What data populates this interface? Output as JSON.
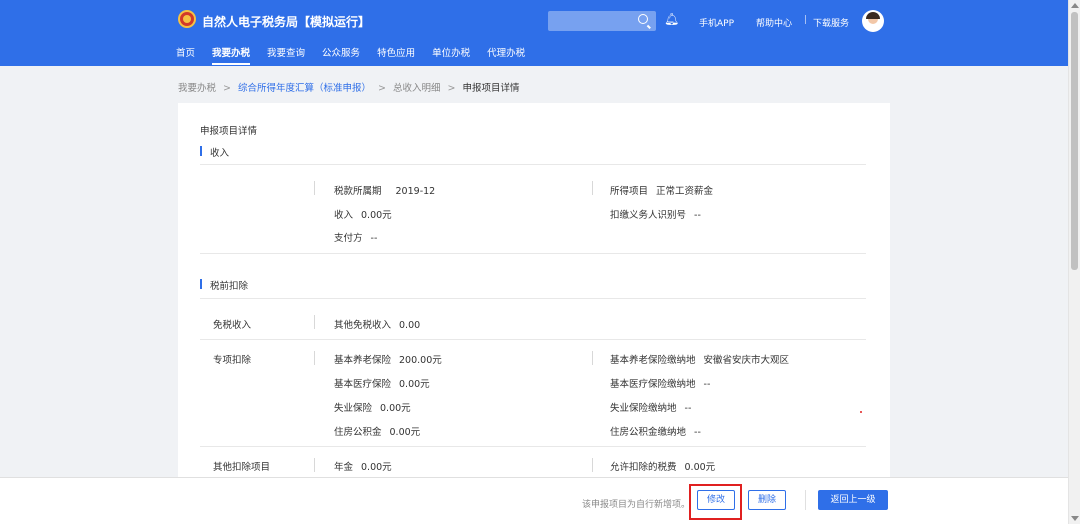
{
  "header": {
    "title": "自然人电子税务局【模拟运行】",
    "links": {
      "mobile_app": "手机APP",
      "help": "帮助中心",
      "sep": "|",
      "download": "下载服务"
    },
    "nav": [
      "首页",
      "我要办税",
      "我要查询",
      "公众服务",
      "特色应用",
      "单位办税",
      "代理办税"
    ],
    "active_nav": "我要办税",
    "accent_color": "#2f6fe8"
  },
  "breadcrumb": {
    "items": [
      "我要办税",
      "综合所得年度汇算（标准申报）",
      "总收入明细",
      "申报项目详情"
    ],
    "sep": ">"
  },
  "detail": {
    "card_title": "申报项目详情",
    "income": {
      "heading": "收入",
      "period_label": "税款所属期",
      "period_value": "2019-12",
      "item_label": "所得项目",
      "item_value": "正常工资薪金",
      "income_label": "收入",
      "income_value": "0.00元",
      "withholder_label": "扣缴义务人识别号",
      "withholder_value": "--",
      "payer_label": "支付方",
      "payer_value": "--"
    },
    "deduction": {
      "heading": "税前扣除",
      "exempt": {
        "label": "免税收入",
        "item_label": "其他免税收入",
        "item_value": "0.00"
      },
      "special": {
        "label": "专项扣除",
        "pension_label": "基本养老保险",
        "pension_value": "200.00元",
        "pension_place_label": "基本养老保险缴纳地",
        "pension_place_value": "安徽省安庆市大观区",
        "medical_label": "基本医疗保险",
        "medical_value": "0.00元",
        "medical_place_label": "基本医疗保险缴纳地",
        "medical_place_value": "--",
        "unemp_label": "失业保险",
        "unemp_value": "0.00元",
        "unemp_place_label": "失业保险缴纳地",
        "unemp_place_value": "--",
        "housing_label": "住房公积金",
        "housing_value": "0.00元",
        "housing_place_label": "住房公积金缴纳地",
        "housing_place_value": "--"
      },
      "other": {
        "label": "其他扣除项目",
        "annuity_label": "年金",
        "annuity_value": "0.00元",
        "tax_label": "允许扣除的税费",
        "tax_value": "0.00元"
      }
    }
  },
  "footer": {
    "note": "该申报项目为自行新增项。",
    "modify": "修改",
    "delete": "删除",
    "back": "返回上一级"
  },
  "icons": {
    "search": "search-icon",
    "bell": "bell-icon",
    "logo": "emblem-icon"
  }
}
